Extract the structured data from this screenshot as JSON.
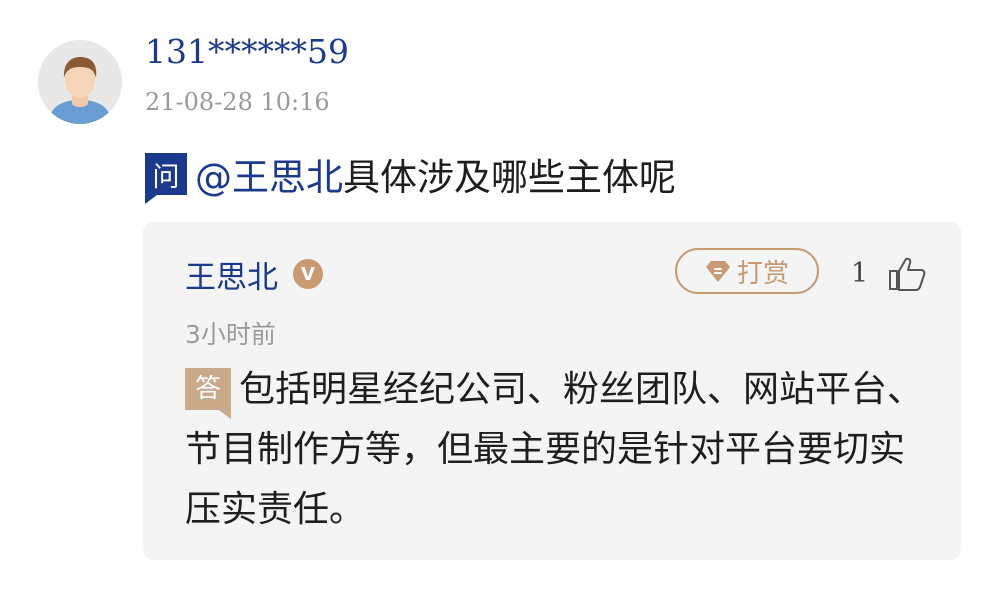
{
  "asker": {
    "avatar_icon": "user-avatar-icon",
    "name": "131******59",
    "time": "21-08-28 10:16"
  },
  "question": {
    "badge": "问",
    "mention": "@王思北",
    "text": "具体涉及哪些主体呢"
  },
  "answer": {
    "author": "王思北",
    "verified_badge": "V",
    "reward_label": "打赏",
    "reward_icon": "gem-icon",
    "like_count": "1",
    "like_icon": "thumbs-up-icon",
    "time": "3小时前",
    "badge": "答",
    "text": "包括明星经纪公司、粉丝团队、网站平台、节目制作方等，但最主要的是针对平台要切实压实责任。"
  },
  "colors": {
    "brand_blue": "#1c3a8c",
    "accent_gold": "#c89a72",
    "answer_badge": "#c9a98a",
    "card_bg": "#f4f4f4",
    "muted_text": "#9a9a9a"
  }
}
